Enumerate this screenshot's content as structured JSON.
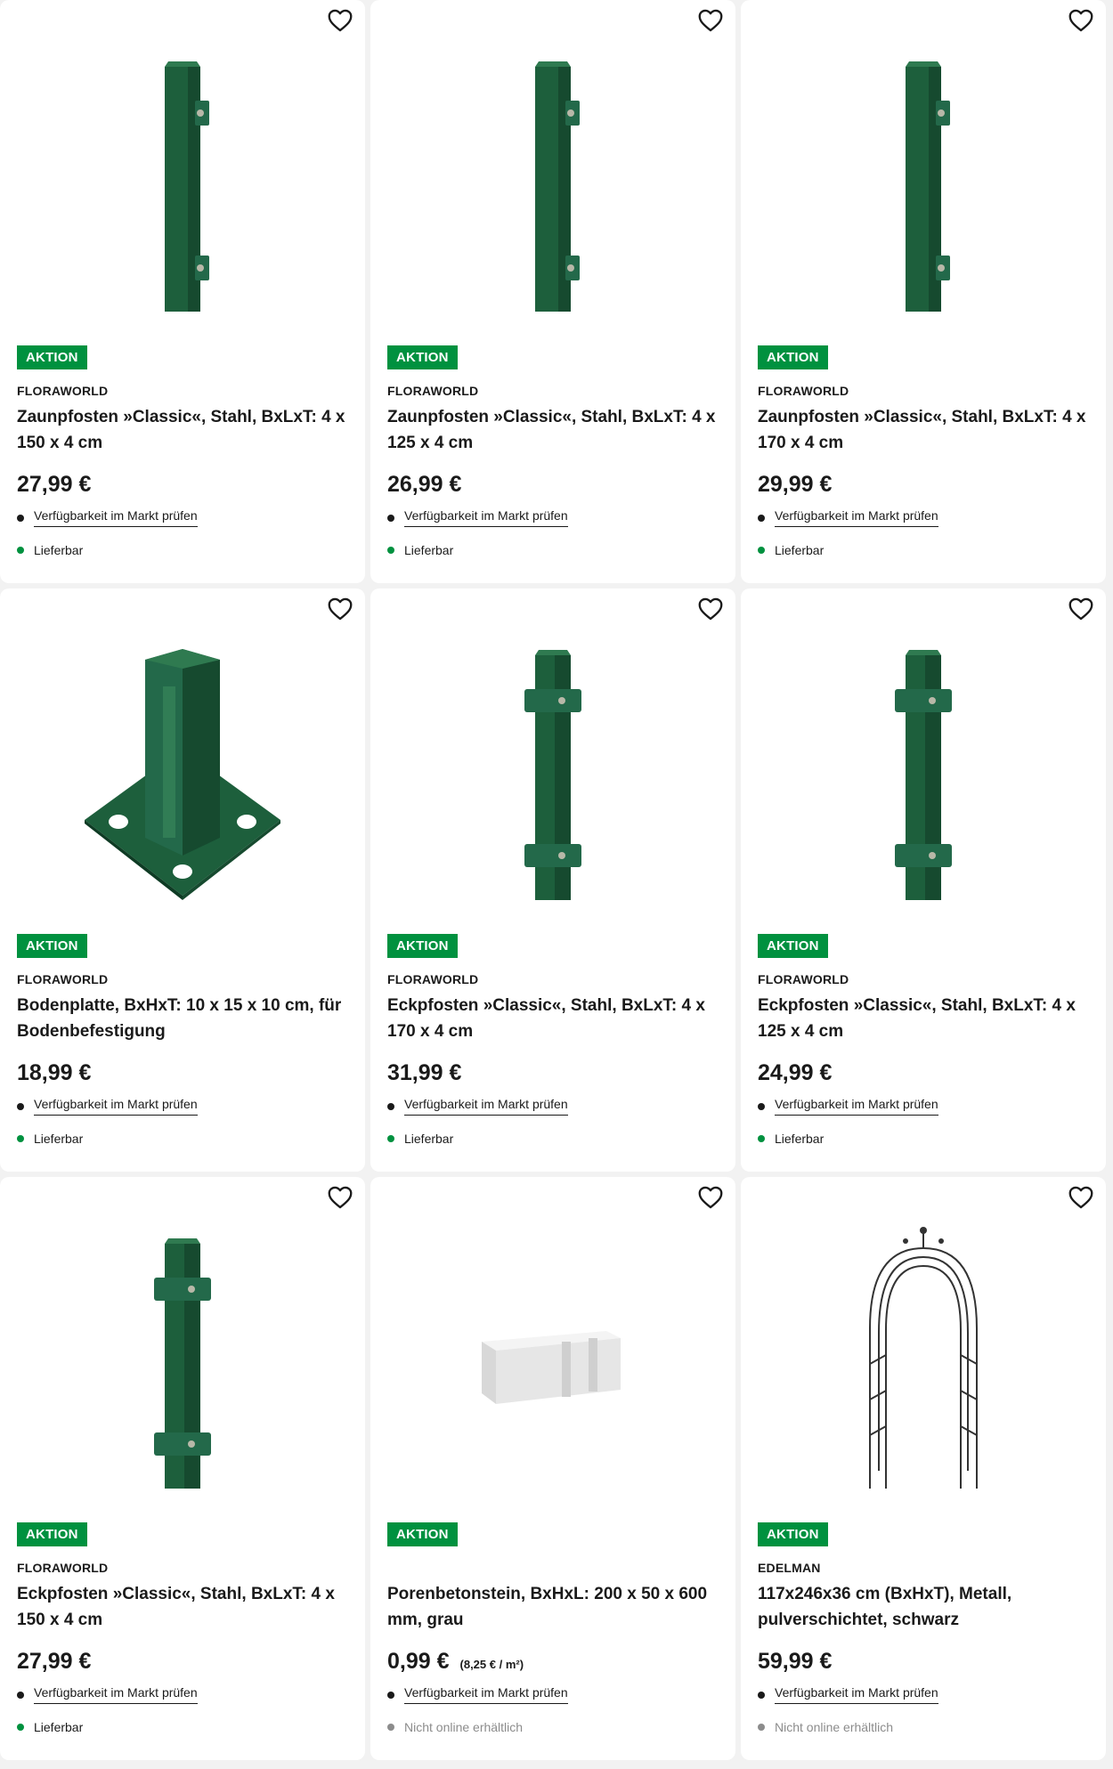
{
  "colors": {
    "accent_green": "#00913f",
    "post_green": "#1d5f3c",
    "dot_available": "#00913f",
    "dot_unavailable": "#8c8c8c"
  },
  "icons": {
    "wishlist": "heart-outline-icon"
  },
  "products": [
    {
      "badge": "AKTION",
      "brand": "FLORAWORLD",
      "title": "Zaunpfosten »Classic«, Stahl, BxLxT: 4 x 150 x 4 cm",
      "price": "27,99 €",
      "unit_price": "",
      "availability_link": "Verfügbarkeit im Markt prüfen",
      "status": "Lieferbar",
      "image": "fence-post"
    },
    {
      "badge": "AKTION",
      "brand": "FLORAWORLD",
      "title": "Zaunpfosten »Classic«, Stahl, BxLxT: 4 x 125 x 4 cm",
      "price": "26,99 €",
      "unit_price": "",
      "availability_link": "Verfügbarkeit im Markt prüfen",
      "status": "Lieferbar",
      "image": "fence-post"
    },
    {
      "badge": "AKTION",
      "brand": "FLORAWORLD",
      "title": "Zaunpfosten »Classic«, Stahl, BxLxT: 4 x 170 x 4 cm",
      "price": "29,99 €",
      "unit_price": "",
      "availability_link": "Verfügbarkeit im Markt prüfen",
      "status": "Lieferbar",
      "image": "fence-post"
    },
    {
      "badge": "AKTION",
      "brand": "FLORAWORLD",
      "title": "Bodenplatte, BxHxT: 10 x 15 x 10 cm, für Bodenbefestigung",
      "price": "18,99 €",
      "unit_price": "",
      "availability_link": "Verfügbarkeit im Markt prüfen",
      "status": "Lieferbar",
      "image": "base-plate"
    },
    {
      "badge": "AKTION",
      "brand": "FLORAWORLD",
      "title": "Eckpfosten »Classic«, Stahl, BxLxT: 4 x 170 x 4 cm",
      "price": "31,99 €",
      "unit_price": "",
      "availability_link": "Verfügbarkeit im Markt prüfen",
      "status": "Lieferbar",
      "image": "corner-post"
    },
    {
      "badge": "AKTION",
      "brand": "FLORAWORLD",
      "title": "Eckpfosten »Classic«, Stahl, BxLxT: 4 x 125 x 4 cm",
      "price": "24,99 €",
      "unit_price": "",
      "availability_link": "Verfügbarkeit im Markt prüfen",
      "status": "Lieferbar",
      "image": "corner-post"
    },
    {
      "badge": "AKTION",
      "brand": "FLORAWORLD",
      "title": "Eckpfosten »Classic«, Stahl, BxLxT: 4 x 150 x 4 cm",
      "price": "27,99 €",
      "unit_price": "",
      "availability_link": "Verfügbarkeit im Markt prüfen",
      "status": "Lieferbar",
      "image": "corner-post"
    },
    {
      "badge": "AKTION",
      "brand": "",
      "title": "Porenbetonstein, BxHxL: 200 x 50 x 600 mm, grau",
      "price": "0,99 €",
      "unit_price": "(8,25 € / m²)",
      "availability_link": "Verfügbarkeit im Markt prüfen",
      "status": "Nicht online erhältlich",
      "image": "aerated-concrete-block"
    },
    {
      "badge": "AKTION",
      "brand": "EDELMAN",
      "title": "117x246x36 cm (BxHxT), Metall, pulverschichtet, schwarz",
      "price": "59,99 €",
      "unit_price": "",
      "availability_link": "Verfügbarkeit im Markt prüfen",
      "status": "Nicht online erhältlich",
      "image": "garden-arch"
    }
  ]
}
